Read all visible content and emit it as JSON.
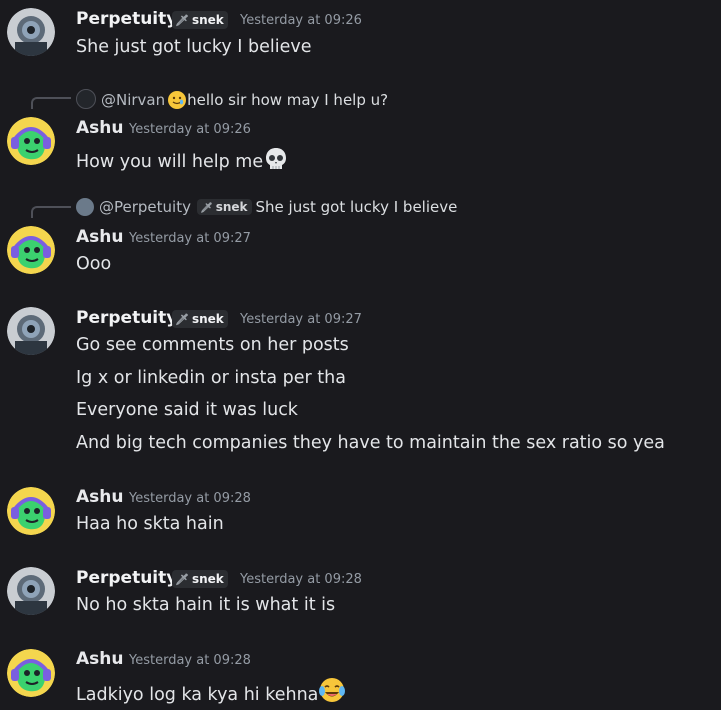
{
  "messages": [
    {
      "author": "Perpetuity",
      "badge": "snek",
      "timestamp": "Yesterday at 09:26",
      "lines": [
        "She just got lucky I believe"
      ]
    },
    {
      "reply": {
        "to": "@Nirvan",
        "text": "hello sir how may I help u?"
      },
      "author": "Ashu",
      "timestamp": "Yesterday at 09:26",
      "lines": [
        "How you will help me"
      ]
    },
    {
      "reply": {
        "to": "@Perpetuity",
        "badge": "snek",
        "text": "She just got lucky I believe"
      },
      "author": "Ashu",
      "timestamp": "Yesterday at 09:27",
      "lines": [
        "Ooo"
      ]
    },
    {
      "author": "Perpetuity",
      "badge": "snek",
      "timestamp": "Yesterday at 09:27",
      "lines": [
        "Go see comments on her posts",
        "Ig x or linkedin or insta per tha",
        "Everyone said it was luck",
        "And big tech companies they have to maintain the sex ratio so yea"
      ]
    },
    {
      "author": "Ashu",
      "timestamp": "Yesterday at 09:28",
      "lines": [
        "Haa ho skta hain"
      ]
    },
    {
      "author": "Perpetuity",
      "badge": "snek",
      "timestamp": "Yesterday at 09:28",
      "lines": [
        "No ho skta hain it is what it is"
      ]
    },
    {
      "author": "Ashu",
      "timestamp": "Yesterday at 09:28",
      "lines": [
        "Ladkiyo log ka kya hi kehna"
      ]
    }
  ],
  "icons": {
    "skull": "skull-emoji",
    "laugh": "tears-of-joy-emoji",
    "smile": "smiling-face-with-tear-emoji",
    "sword": "sword-icon"
  },
  "colors": {
    "background": "#1a1a1e",
    "timestamp": "#949ba4",
    "badge_bg": "#2b2d31",
    "ashu_avatar_bg": "#f4d64e",
    "ashu_avatar_fg": "#3bd16f"
  }
}
